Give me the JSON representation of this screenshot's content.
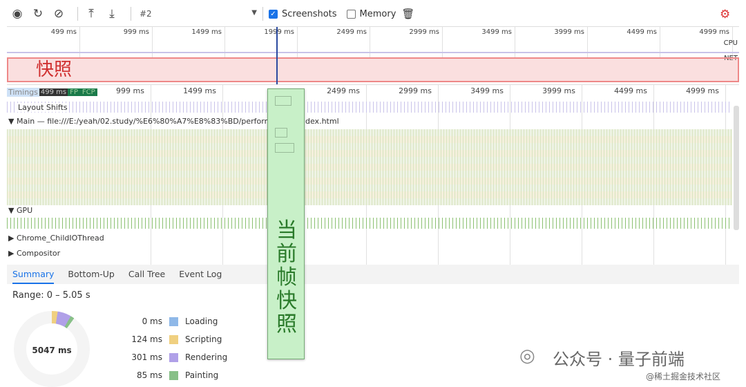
{
  "toolbar": {
    "icons": [
      "record-icon",
      "reload-icon",
      "clear-icon",
      "upload-icon",
      "download-icon"
    ],
    "profile": "#2",
    "screenshots_label": "Screenshots",
    "screenshots_checked": true,
    "memory_label": "Memory",
    "memory_checked": false
  },
  "overview": {
    "ticks": [
      "499 ms",
      "999 ms",
      "1499 ms",
      "1999 ms",
      "2499 ms",
      "2999 ms",
      "3499 ms",
      "3999 ms",
      "4499 ms",
      "4999 ms"
    ],
    "cpu_label": "CPU",
    "net_label": "NET"
  },
  "annotations": {
    "snapshot": "快照",
    "current_frame": [
      "当",
      "前",
      "帧",
      "快",
      "照"
    ],
    "red": "#e05050",
    "green": "#c8f0c8"
  },
  "timeline": {
    "ticks": [
      "999 ms",
      "1499 ms",
      "2499 ms",
      "2999 ms",
      "3499 ms",
      "3999 ms",
      "4499 ms",
      "4999 ms"
    ],
    "timings_label": "Timings",
    "timings_partial_tick": "499 ms",
    "fp": "FP",
    "fcp": "FCP",
    "layout_shifts": "Layout Shifts",
    "main": "Main — file:///E:/yeah/02.study/%E6%80%A7%E8%83%BD/performance",
    "main_suffix": "dex.html",
    "gpu": "GPU",
    "child_io": "Chrome_ChildIOThread",
    "compositor": "Compositor"
  },
  "bottom": {
    "tabs": [
      "Summary",
      "Bottom-Up",
      "Call Tree",
      "Event Log"
    ],
    "range": "Range: 0 – 5.05 s",
    "total": "5047 ms",
    "legend": [
      {
        "value": "0 ms",
        "label": "Loading",
        "color": "#8fb8e8"
      },
      {
        "value": "124 ms",
        "label": "Scripting",
        "color": "#f0d080"
      },
      {
        "value": "301 ms",
        "label": "Rendering",
        "color": "#b0a0e8"
      },
      {
        "value": "85 ms",
        "label": "Painting",
        "color": "#88c088"
      }
    ]
  },
  "watermark": {
    "wechat": "公众号 · 量子前端",
    "juejin": "@稀土掘金技术社区"
  }
}
